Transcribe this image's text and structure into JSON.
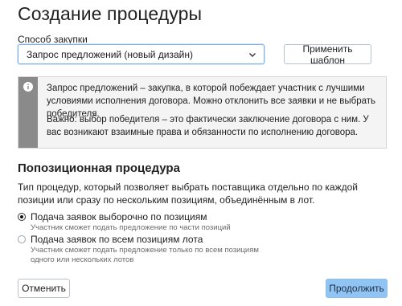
{
  "page": {
    "title": "Создание процедуры"
  },
  "procurement": {
    "label": "Способ закупки",
    "selected": "Запрос предложений (новый дизайн)",
    "apply_template_label": "Применить шаблон"
  },
  "notice": {
    "paragraph1": "Запрос предложений – закупка, в которой побеждает участник с лучшими условиями исполнения договора. Можно отклонить все заявки и не выбрать победителя.",
    "paragraph2": "Важно: выбор победителя – это фактически заключение договора с ним. У вас возникают взаимные права и обязанности по исполнению договора."
  },
  "section": {
    "title": "Попозиционная процедура",
    "description": "Тип процедур, который позволяет выбрать поставщика отдельно по каждой позиции или сразу по нескольким позициям, объединённым в лот."
  },
  "options": [
    {
      "label": "Подача заявок выборочно по позициям",
      "hint": "Участник сможет подать предложение по части позиций",
      "checked": true
    },
    {
      "label": "Подача заявок по всем позициям лота",
      "hint": "Участник сможет подать предложение только по всем позициям одного или нескольких лотов",
      "checked": false
    }
  ],
  "footer": {
    "cancel_label": "Отменить",
    "continue_label": "Продолжить"
  },
  "icons": {
    "select": "chevron-down-icon",
    "notice": "info-icon"
  },
  "colors": {
    "accent_border": "#7ab1e8",
    "primary_button": "#90c4f5",
    "notice_stripe": "#8a8a8a",
    "notice_bg": "#f4f4f4"
  }
}
